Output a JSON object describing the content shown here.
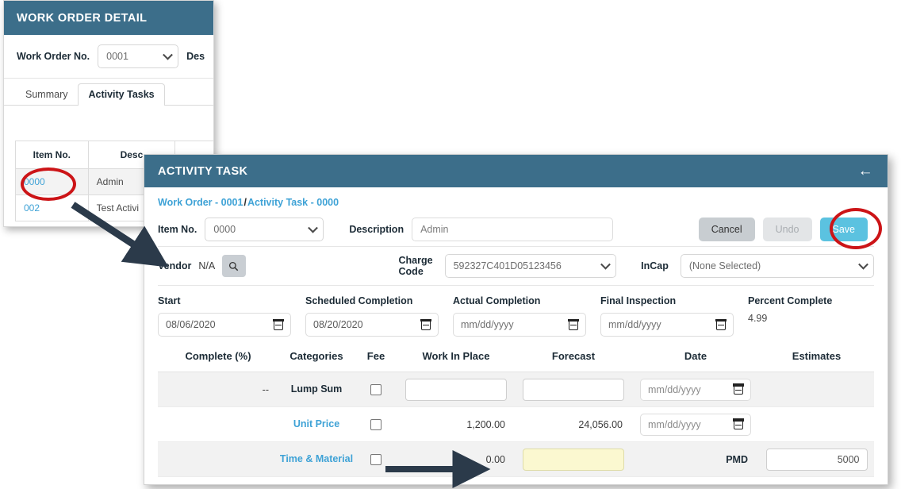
{
  "work_order_panel": {
    "title": "WORK ORDER DETAIL",
    "work_order_label": "Work Order No.",
    "work_order_value": "0001",
    "description_label": "Des",
    "tabs": [
      {
        "label": "Summary",
        "active": false
      },
      {
        "label": "Activity Tasks",
        "active": true
      }
    ],
    "table": {
      "headers": [
        "Item No.",
        "Desc"
      ],
      "rows": [
        {
          "item_no": "0000",
          "description": "Admin"
        },
        {
          "item_no": "002",
          "description": "Test Activi"
        }
      ]
    }
  },
  "activity_task_panel": {
    "title": "ACTIVITY TASK",
    "back_icon": "back-arrow-icon",
    "breadcrumb": {
      "parent": "Work Order - 0001",
      "separator": "/",
      "current": "Activity Task - 0000"
    },
    "item_no_label": "Item No.",
    "item_no_value": "0000",
    "description_label": "Description",
    "description_value": "Admin",
    "buttons": {
      "cancel": "Cancel",
      "undo": "Undo",
      "save": "Save"
    },
    "vendor_label": "Vendor",
    "vendor_value": "N/A",
    "vendor_search_icon": "search-icon",
    "charge_code_label_line1": "Charge",
    "charge_code_label_line2": "Code",
    "charge_code_value": "592327C401D05123456",
    "incap_label": "InCap",
    "incap_value": "(None Selected)",
    "dates": [
      {
        "label": "Start",
        "value": "08/06/2020",
        "placeholder": "mm/dd/yyyy"
      },
      {
        "label": "Scheduled Completion",
        "value": "08/20/2020",
        "placeholder": "mm/dd/yyyy"
      },
      {
        "label": "Actual Completion",
        "value": "",
        "placeholder": "mm/dd/yyyy"
      },
      {
        "label": "Final Inspection",
        "value": "",
        "placeholder": "mm/dd/yyyy"
      }
    ],
    "percent_complete_label": "Percent Complete",
    "percent_complete_value": "4.99",
    "grid": {
      "headers": [
        "Complete (%)",
        "Categories",
        "Fee",
        "Work In Place",
        "Forecast",
        "Date",
        "Estimates"
      ],
      "rows": [
        {
          "complete": "--",
          "category": "Lump Sum",
          "category_is_link": false,
          "fee_checked": false,
          "work_in_place": "",
          "work_in_place_is_input": true,
          "forecast": "",
          "forecast_is_input": true,
          "forecast_highlight": false,
          "date_placeholder": "mm/dd/yyyy",
          "has_date_input": true,
          "estimate_label": "",
          "estimate_value": "",
          "has_estimate_input": false
        },
        {
          "complete": "",
          "category": "Unit Price",
          "category_is_link": true,
          "fee_checked": false,
          "work_in_place": "1,200.00",
          "work_in_place_is_input": false,
          "forecast": "24,056.00",
          "forecast_is_input": false,
          "forecast_highlight": false,
          "date_placeholder": "mm/dd/yyyy",
          "has_date_input": true,
          "estimate_label": "",
          "estimate_value": "",
          "has_estimate_input": false
        },
        {
          "complete": "",
          "category": "Time & Material",
          "category_is_link": true,
          "fee_checked": false,
          "work_in_place": "0.00",
          "work_in_place_is_input": false,
          "forecast": "",
          "forecast_is_input": true,
          "forecast_highlight": true,
          "date_placeholder": "",
          "has_date_input": false,
          "estimate_label": "PMD",
          "estimate_value": "5000",
          "has_estimate_input": true
        }
      ]
    }
  },
  "annotations": {
    "highlight_item_no": "0000",
    "highlight_save": "Save",
    "pointer_arrow_from_table_to_panel": true,
    "pointer_arrow_to_forecast_cell": true
  },
  "colors": {
    "header_teal": "#3c6e8a",
    "link_blue": "#3ea2d6",
    "save_blue": "#5bc2e0",
    "annotation_red": "#cc1417",
    "arrow_navy": "#2b3a4a",
    "highlight_yellow": "#fbf8d0"
  }
}
